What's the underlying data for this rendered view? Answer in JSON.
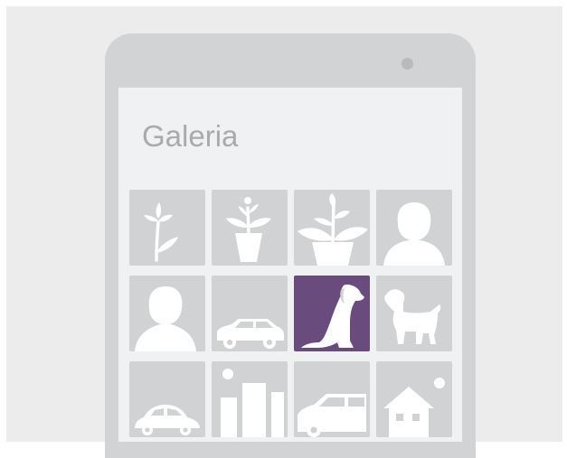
{
  "gallery": {
    "title": "Galeria",
    "tiles": [
      {
        "icon": "flower-icon"
      },
      {
        "icon": "potted-plant-icon"
      },
      {
        "icon": "potted-plant-large-icon"
      },
      {
        "icon": "person-portrait-icon"
      },
      {
        "icon": "person-portrait-icon"
      },
      {
        "icon": "car-icon"
      },
      {
        "icon": "dog-sitting-icon",
        "selected": true
      },
      {
        "icon": "dog-standing-icon"
      },
      {
        "icon": "beetle-car-icon"
      },
      {
        "icon": "buildings-icon"
      },
      {
        "icon": "car-icon"
      },
      {
        "icon": "house-icon"
      }
    ]
  },
  "colors": {
    "selected_tile": "#6a4b7d",
    "tile": "#d1d2d4",
    "screen": "#f0f1f3",
    "phone_frame": "#d2d3d5",
    "title_text": "#a9aaac"
  }
}
